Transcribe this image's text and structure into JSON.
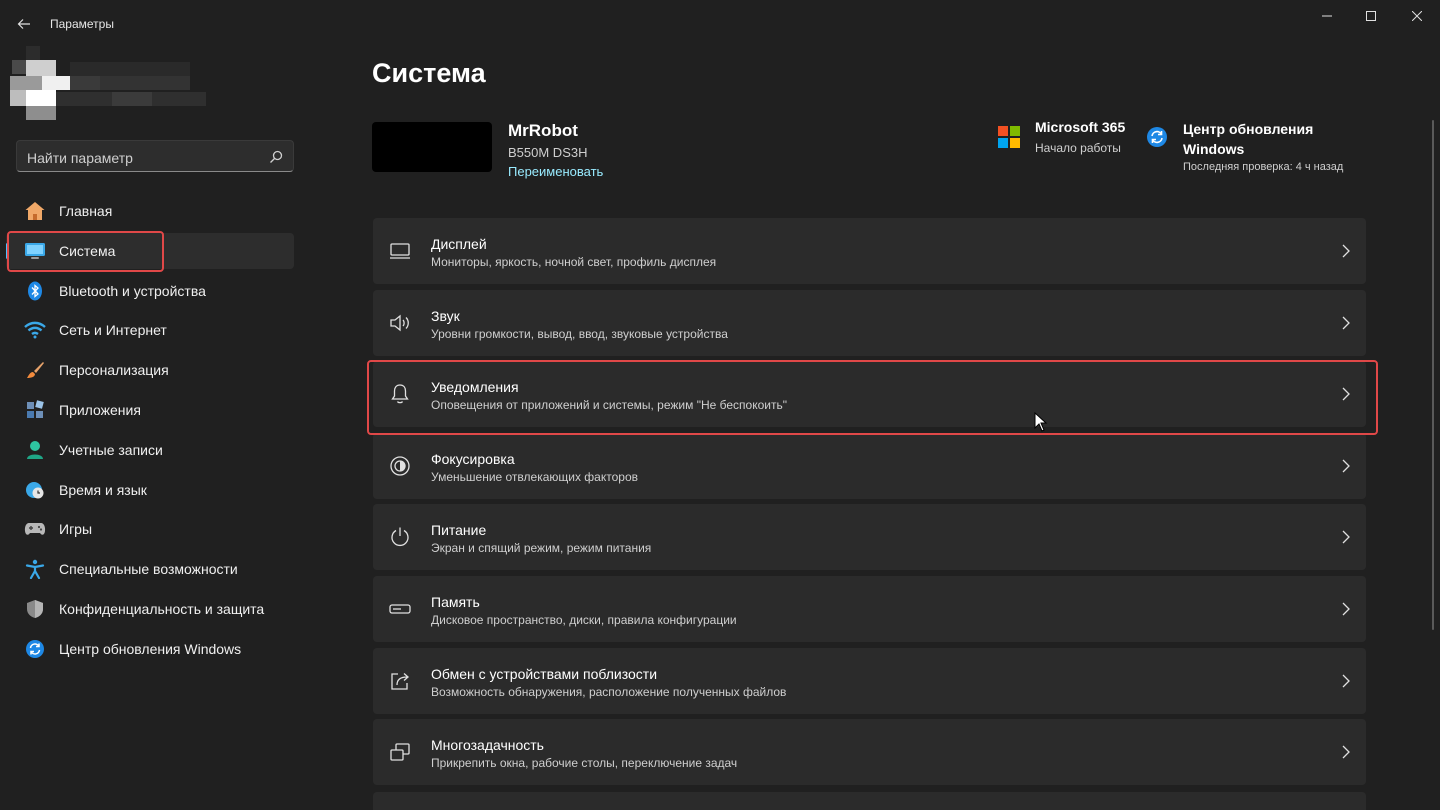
{
  "window": {
    "app_title": "Параметры"
  },
  "search": {
    "placeholder": "Найти параметр"
  },
  "sidebar": {
    "items": [
      {
        "label": "Главная",
        "icon": "home-icon"
      },
      {
        "label": "Система",
        "icon": "monitor-icon",
        "active": true
      },
      {
        "label": "Bluetooth и устройства",
        "icon": "bluetooth-icon"
      },
      {
        "label": "Сеть и Интернет",
        "icon": "wifi-icon"
      },
      {
        "label": "Персонализация",
        "icon": "brush-icon"
      },
      {
        "label": "Приложения",
        "icon": "apps-icon"
      },
      {
        "label": "Учетные записи",
        "icon": "account-icon"
      },
      {
        "label": "Время и язык",
        "icon": "globe-clock-icon"
      },
      {
        "label": "Игры",
        "icon": "gamepad-icon"
      },
      {
        "label": "Специальные возможности",
        "icon": "accessibility-icon"
      },
      {
        "label": "Конфиденциальность и защита",
        "icon": "shield-icon"
      },
      {
        "label": "Центр обновления Windows",
        "icon": "update-icon"
      }
    ]
  },
  "main": {
    "title": "Система",
    "device": {
      "name": "MrRobot",
      "model": "B550M DS3H",
      "rename_label": "Переименовать"
    },
    "quick": {
      "ms365": {
        "title": "Microsoft 365",
        "subtitle": "Начало работы"
      },
      "update": {
        "title": "Центр обновления Windows",
        "subtitle": "Последняя проверка: 4 ч назад"
      }
    },
    "cards": [
      {
        "title": "Дисплей",
        "subtitle": "Мониторы, яркость, ночной свет, профиль дисплея",
        "icon": "display-icon"
      },
      {
        "title": "Звук",
        "subtitle": "Уровни громкости, вывод, ввод, звуковые устройства",
        "icon": "speaker-icon"
      },
      {
        "title": "Уведомления",
        "subtitle": "Оповещения от приложений и системы, режим \"Не беспокоить\"",
        "icon": "bell-icon",
        "highlighted": true
      },
      {
        "title": "Фокусировка",
        "subtitle": "Уменьшение отвлекающих факторов",
        "icon": "focus-icon"
      },
      {
        "title": "Питание",
        "subtitle": "Экран и спящий режим, режим питания",
        "icon": "power-icon"
      },
      {
        "title": "Память",
        "subtitle": "Дисковое пространство, диски, правила конфигурации",
        "icon": "storage-icon"
      },
      {
        "title": "Обмен с устройствами поблизости",
        "subtitle": "Возможность обнаружения, расположение полученных файлов",
        "icon": "share-icon"
      },
      {
        "title": "Многозадачность",
        "subtitle": "Прикрепить окна, рабочие столы, переключение задач",
        "icon": "multitask-icon"
      }
    ]
  },
  "colors": {
    "accent": "#4cc2ff",
    "highlight_box": "#e04848",
    "link": "#99ebff",
    "background": "#202020",
    "card": "#2b2b2b"
  }
}
